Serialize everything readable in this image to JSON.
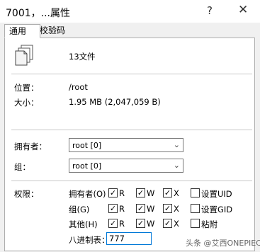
{
  "window": {
    "title": "7001，...属性",
    "help": "?",
    "close": "✕"
  },
  "tabs": [
    {
      "label": "通用"
    },
    {
      "label": "校验码"
    }
  ],
  "file": {
    "icon": "file-stack-icon",
    "count_label": "13文件"
  },
  "info": {
    "location_label": "位置：",
    "location_value": "/root",
    "size_label": "大小：",
    "size_value": "1.95 MB (2,047,059 B)"
  },
  "ownership": {
    "owner_label": "拥有者：",
    "owner_value": "root [0]",
    "group_label": "组：",
    "group_value": "root [0]"
  },
  "permissions": {
    "label": "权限：",
    "rows": [
      {
        "label": "拥有者(O)",
        "r": "R",
        "w": "W",
        "x": "X",
        "extra": "设置UID"
      },
      {
        "label": "组(G)",
        "r": "R",
        "w": "W",
        "x": "X",
        "extra": "设置GID"
      },
      {
        "label": "其他(H)",
        "r": "R",
        "w": "W",
        "x": "X",
        "extra": "粘附"
      }
    ],
    "octal_label": "八进制表：",
    "octal_value": "777"
  },
  "watermark": "头条 @艾西ONEPIECE",
  "colors": {
    "accent": "#0078d7",
    "panel": "#ffffff",
    "background": "#f0f0f0"
  }
}
